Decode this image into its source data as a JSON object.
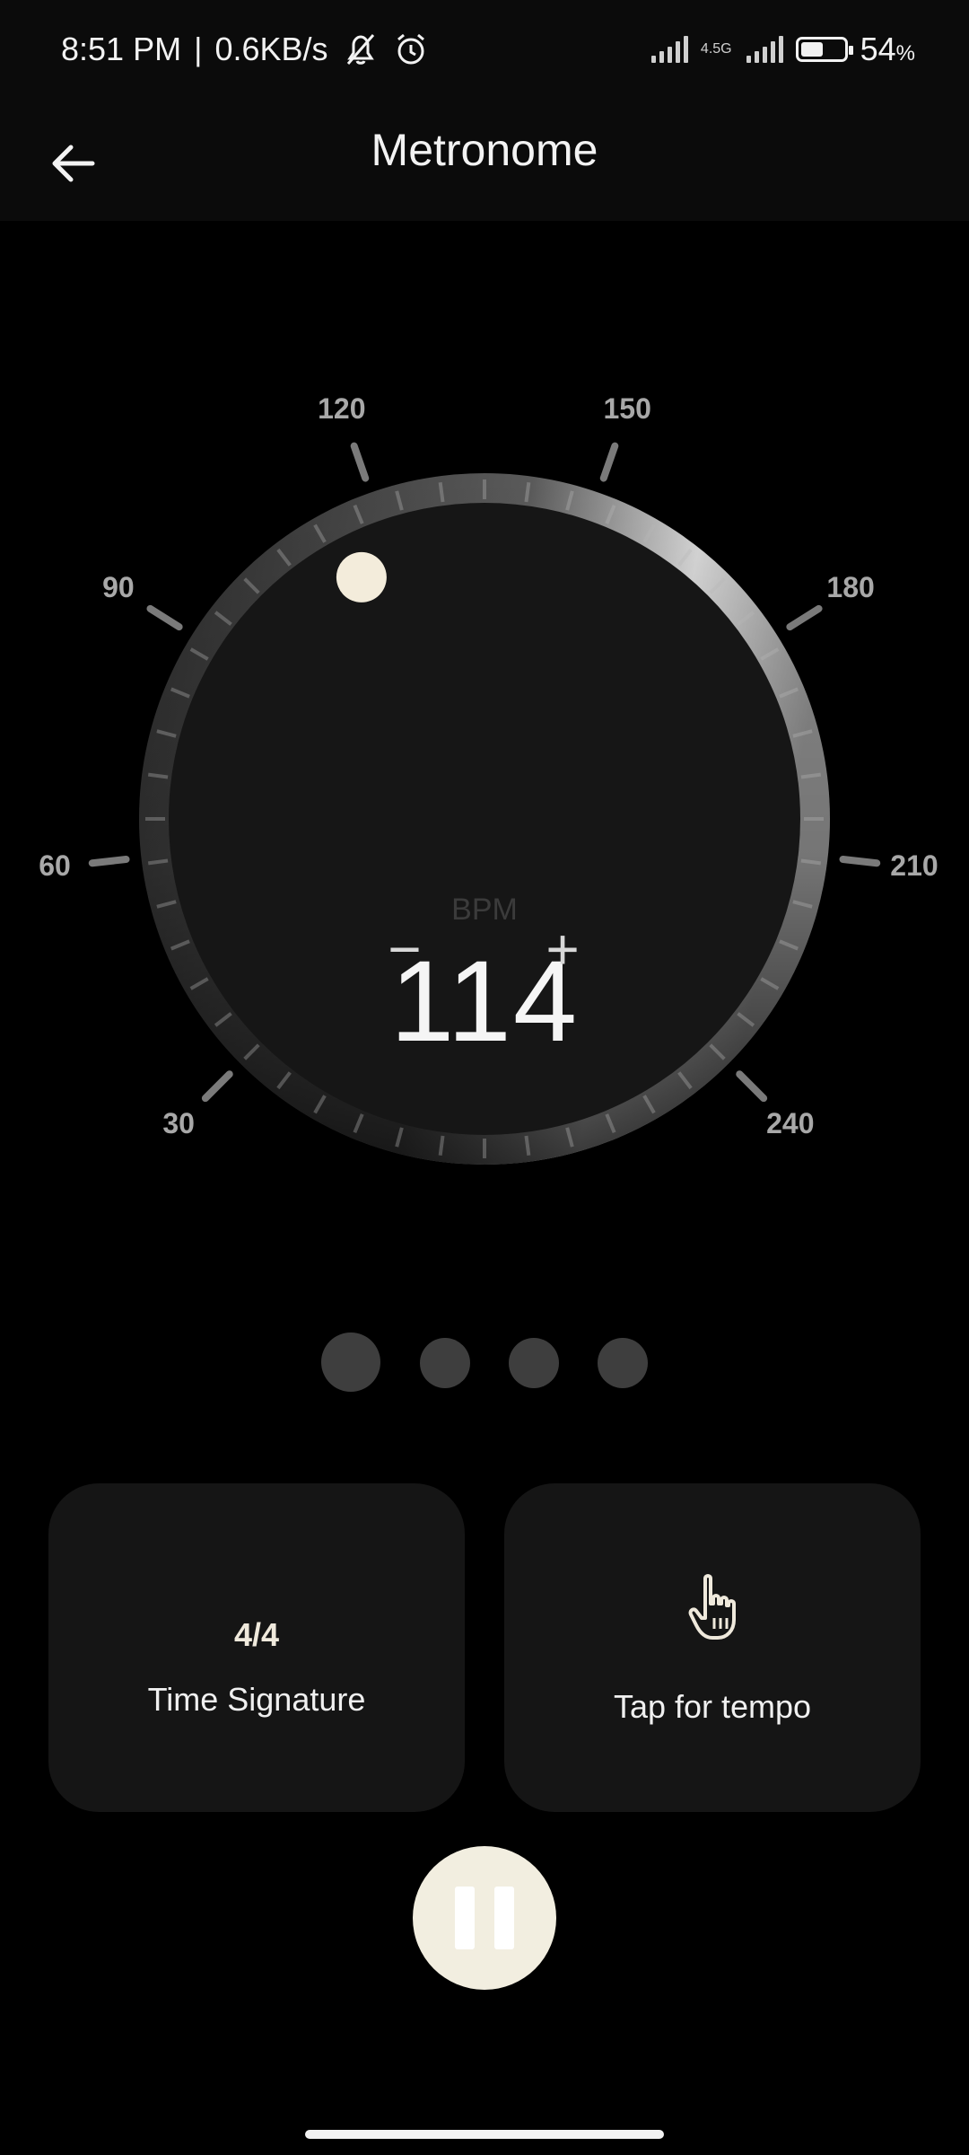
{
  "status_bar": {
    "time": "8:51 PM",
    "network_speed": "0.6KB/s",
    "net_type": "4.5G",
    "battery_percent": "54",
    "battery_level": 0.54
  },
  "app_bar": {
    "title": "Metronome",
    "back_icon": "arrow-left-icon"
  },
  "dial": {
    "tick_labels": [
      "30",
      "60",
      "90",
      "120",
      "150",
      "180",
      "210",
      "240"
    ],
    "bpm_label": "BPM",
    "bpm_value": "114",
    "minus_symbol": "−",
    "plus_symbol": "+"
  },
  "beats": {
    "count": 4,
    "active_index": 0
  },
  "time_signature_card": {
    "value": "4/4",
    "label": "Time Signature"
  },
  "tap_tempo_card": {
    "label": "Tap for tempo",
    "icon": "pointing-hand-icon"
  },
  "play_control": {
    "state": "playing",
    "icon": "pause-icon"
  },
  "colors": {
    "background": "#000000",
    "card": "#151515",
    "accent": "#f2eee0"
  }
}
